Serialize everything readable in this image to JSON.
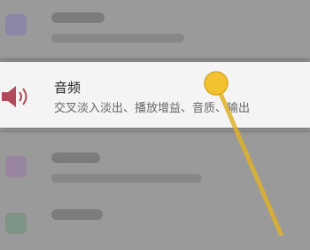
{
  "settings_item": {
    "title": "音频",
    "subtitle": "交叉淡入淡出、播放增益、音质、输出",
    "icon": "speaker-icon"
  },
  "colors": {
    "overlay": "#9a9a9a",
    "card": "#f4f4f4",
    "speaker": "#b24a5a",
    "pointer": "#f2c230"
  }
}
